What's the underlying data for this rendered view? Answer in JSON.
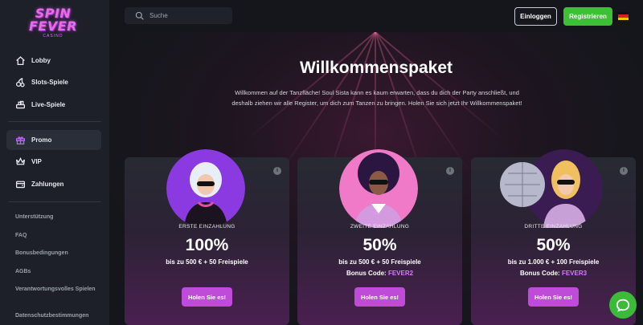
{
  "logo": {
    "line1": "SPIN",
    "line2": "FEVER",
    "line3": "CASINO"
  },
  "sidebar": {
    "items": [
      {
        "label": "Lobby",
        "icon": "home-icon"
      },
      {
        "label": "Slots-Spiele",
        "icon": "cherries-icon"
      },
      {
        "label": "Live-Spiele",
        "icon": "cards-table-icon"
      },
      {
        "label": "Promo",
        "icon": "gift-icon",
        "active": true
      },
      {
        "label": "VIP",
        "icon": "crown-icon"
      },
      {
        "label": "Zahlungen",
        "icon": "wallet-icon"
      }
    ],
    "links": [
      "Unterstützung",
      "FAQ",
      "Bonusbedingungen",
      "AGBs",
      "Verantwortungsvolles Spielen",
      "Datenschutzbestimmungen"
    ]
  },
  "header": {
    "search_placeholder": "Suche",
    "login_label": "Einloggen",
    "register_label": "Registrieren",
    "language_flag": "de-flag-icon"
  },
  "main": {
    "title": "Willkommenspaket",
    "intro": "Willkommen auf der Tanzfläche! Soul Sista kann es kaum erwarten, dass du dich der Party anschließt, und deshalb ziehen wir alle Register, um dich zum Tanzen zu bringen. Holen Sie sich jetzt Ihr Willkommenspaket!",
    "cards": [
      {
        "kicker": "ERSTE EINZAHLUNG",
        "percent": "100%",
        "desc": "bis zu 500 € + 50 Freispiele",
        "code_label": "",
        "code": "",
        "cta": "Holen Sie es!"
      },
      {
        "kicker": "ZWEITE EINZAHLUNG",
        "percent": "50%",
        "desc": "bis zu 500 € + 50 Freispiele",
        "code_label": "Bonus Code: ",
        "code": "FEVER2",
        "cta": "Holen Sie es!"
      },
      {
        "kicker": "DRITTE EINZAHLUNG",
        "percent": "50%",
        "desc": "bis zu 1.000 € + 100 Freispiele",
        "code_label": "Bonus Code: ",
        "code": "FEVER3",
        "cta": "Holen Sie es!"
      }
    ]
  },
  "colors": {
    "accent": "#bf4cd8",
    "register": "#3dbf36",
    "chat": "#3cba3a"
  }
}
